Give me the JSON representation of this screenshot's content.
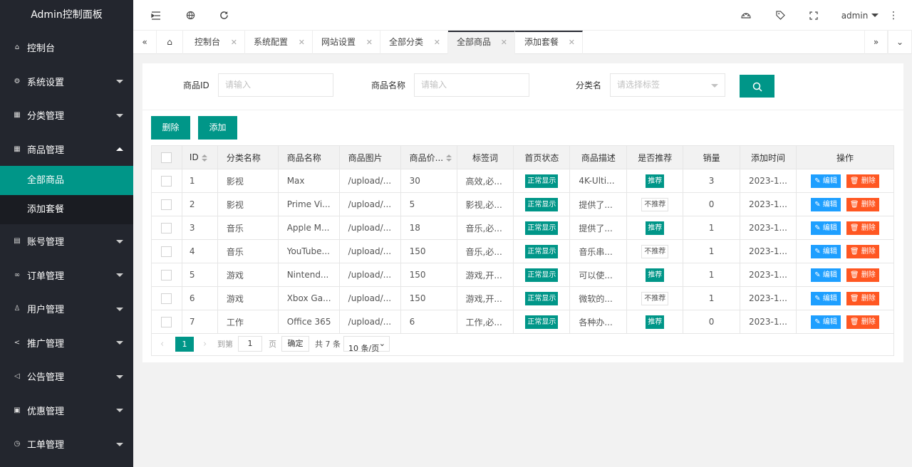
{
  "sidebar": {
    "logo": "Admin控制面板",
    "items": [
      {
        "label": "控制台",
        "icon": "home-icon"
      },
      {
        "label": "系统设置",
        "icon": "gear-icon"
      },
      {
        "label": "分类管理",
        "icon": "category-icon"
      },
      {
        "label": "商品管理",
        "icon": "goods-icon"
      },
      {
        "label": "账号管理",
        "icon": "account-icon"
      },
      {
        "label": "订单管理",
        "icon": "order-icon"
      },
      {
        "label": "用户管理",
        "icon": "user-icon"
      },
      {
        "label": "推广管理",
        "icon": "share-icon"
      },
      {
        "label": "公告管理",
        "icon": "notice-icon"
      },
      {
        "label": "优惠管理",
        "icon": "coupon-icon"
      },
      {
        "label": "工单管理",
        "icon": "ticket-icon"
      }
    ],
    "sub_items": [
      {
        "label": "全部商品"
      },
      {
        "label": "添加套餐"
      }
    ]
  },
  "header": {
    "user": "admin"
  },
  "tabs": [
    {
      "label": "控制台"
    },
    {
      "label": "系统配置"
    },
    {
      "label": "网站设置"
    },
    {
      "label": "全部分类"
    },
    {
      "label": "全部商品"
    },
    {
      "label": "添加套餐"
    }
  ],
  "search": {
    "id_label": "商品ID",
    "id_placeholder": "请输入",
    "name_label": "商品名称",
    "name_placeholder": "请输入",
    "cat_label": "分类名",
    "cat_placeholder": "请选择标签"
  },
  "toolbar": {
    "delete": "删除",
    "add": "添加"
  },
  "table": {
    "headers": [
      "ID",
      "分类名称",
      "商品名称",
      "商品图片",
      "商品价...",
      "标签词",
      "首页状态",
      "商品描述",
      "是否推荐",
      "销量",
      "添加时间",
      "操作"
    ],
    "rows": [
      {
        "id": "1",
        "cat": "影视",
        "name": "Max",
        "img": "/upload/...",
        "price": "30",
        "tags": "高效,必...",
        "status": "正常显示",
        "desc": "4K-Ulti...",
        "rec": "推荐",
        "sales": "3",
        "time": "2023-1..."
      },
      {
        "id": "2",
        "cat": "影视",
        "name": "Prime Vi...",
        "img": "/upload/...",
        "price": "5",
        "tags": "影视,必...",
        "status": "正常显示",
        "desc": "提供了...",
        "rec": "不推荐",
        "sales": "0",
        "time": "2023-1..."
      },
      {
        "id": "3",
        "cat": "音乐",
        "name": "Apple M...",
        "img": "/upload/...",
        "price": "18",
        "tags": "音乐,必...",
        "status": "正常显示",
        "desc": "提供了...",
        "rec": "推荐",
        "sales": "1",
        "time": "2023-1..."
      },
      {
        "id": "4",
        "cat": "音乐",
        "name": "YouTube...",
        "img": "/upload/...",
        "price": "150",
        "tags": "音乐,必...",
        "status": "正常显示",
        "desc": "音乐串...",
        "rec": "不推荐",
        "sales": "1",
        "time": "2023-1..."
      },
      {
        "id": "5",
        "cat": "游戏",
        "name": "Nintend...",
        "img": "/upload/...",
        "price": "150",
        "tags": "游戏,开...",
        "status": "正常显示",
        "desc": "可以使...",
        "rec": "推荐",
        "sales": "1",
        "time": "2023-1..."
      },
      {
        "id": "6",
        "cat": "游戏",
        "name": "Xbox Ga...",
        "img": "/upload/...",
        "price": "150",
        "tags": "游戏,开...",
        "status": "正常显示",
        "desc": "微软的...",
        "rec": "不推荐",
        "sales": "1",
        "time": "2023-1..."
      },
      {
        "id": "7",
        "cat": "工作",
        "name": "Office 365",
        "img": "/upload/...",
        "price": "6",
        "tags": "工作,必...",
        "status": "正常显示",
        "desc": "各种办...",
        "rec": "推荐",
        "sales": "0",
        "time": "2023-1..."
      }
    ],
    "edit": "编辑",
    "del": "删除"
  },
  "pager": {
    "page": "1",
    "goto": "到第",
    "page_input": "1",
    "page_unit": "页",
    "confirm": "确定",
    "total": "共 7 条",
    "per_page": "10 条/页"
  }
}
